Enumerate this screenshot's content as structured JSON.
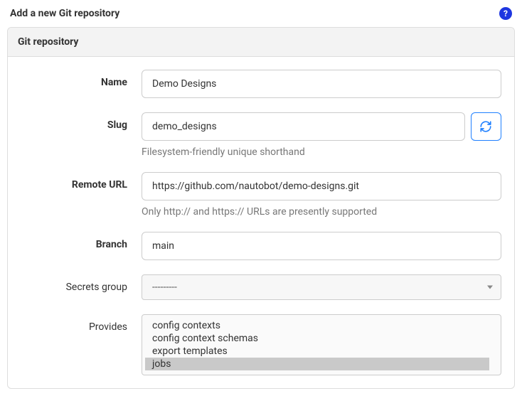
{
  "page": {
    "title": "Add a new Git repository"
  },
  "panel": {
    "title": "Git repository"
  },
  "fields": {
    "name": {
      "label": "Name",
      "value": "Demo Designs"
    },
    "slug": {
      "label": "Slug",
      "value": "demo_designs",
      "help": "Filesystem-friendly unique shorthand"
    },
    "remote_url": {
      "label": "Remote URL",
      "value": "https://github.com/nautobot/demo-designs.git",
      "help": "Only http:// and https:// URLs are presently supported"
    },
    "branch": {
      "label": "Branch",
      "value": "main"
    },
    "secrets_group": {
      "label": "Secrets group",
      "value": "---------"
    },
    "provides": {
      "label": "Provides",
      "options": [
        {
          "label": "config contexts",
          "selected": false
        },
        {
          "label": "config context schemas",
          "selected": false
        },
        {
          "label": "export templates",
          "selected": false
        },
        {
          "label": "jobs",
          "selected": true
        }
      ]
    }
  }
}
